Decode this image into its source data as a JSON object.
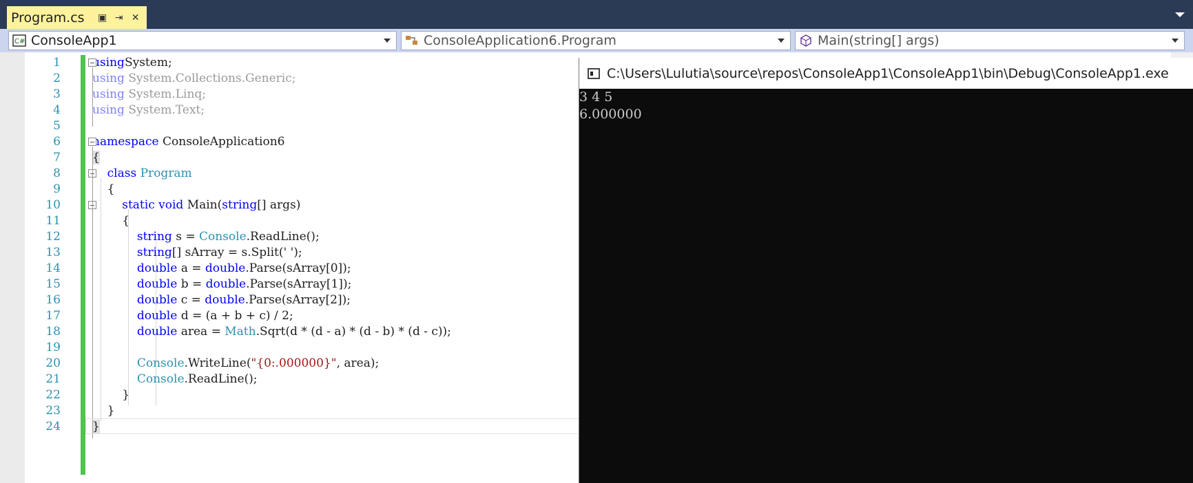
{
  "tab": {
    "title": "Program.cs",
    "pin_glyph": "▣",
    "dock_glyph": "⇥",
    "close_glyph": "✕"
  },
  "navbar": {
    "project": "ConsoleApp1",
    "class": "ConsoleApplication6.Program",
    "member": "Main(string[] args)"
  },
  "line_numbers": [
    "1",
    "2",
    "3",
    "4",
    "5",
    "6",
    "7",
    "8",
    "9",
    "10",
    "11",
    "12",
    "13",
    "14",
    "15",
    "16",
    "17",
    "18",
    "19",
    "20",
    "21",
    "22",
    "23",
    "24"
  ],
  "code_lines": [
    [
      [
        "kw",
        "using"
      ],
      [
        "",
        "System;"
      ]
    ],
    [
      [
        "fade-kw",
        "using"
      ],
      [
        "fade",
        " System.Collections.Generic;"
      ]
    ],
    [
      [
        "fade-kw",
        "using"
      ],
      [
        "fade",
        " System.Linq;"
      ]
    ],
    [
      [
        "fade-kw",
        "using"
      ],
      [
        "fade",
        " System.Text;"
      ]
    ],
    [],
    [
      [
        "kw",
        "namespace"
      ],
      [
        "",
        " ConsoleApplication6"
      ]
    ],
    [
      [
        "brace-hl",
        "{"
      ]
    ],
    [
      [
        "",
        "    "
      ],
      [
        "kw",
        "class"
      ],
      [
        "",
        " "
      ],
      [
        "ty",
        "Program"
      ]
    ],
    [
      [
        "",
        "    {"
      ]
    ],
    [
      [
        "",
        "        "
      ],
      [
        "kw",
        "static"
      ],
      [
        "",
        " "
      ],
      [
        "kw",
        "void"
      ],
      [
        "",
        " Main("
      ],
      [
        "kw",
        "string"
      ],
      [
        "",
        "[] args)"
      ]
    ],
    [
      [
        "",
        "        {"
      ]
    ],
    [
      [
        "",
        "            "
      ],
      [
        "kw",
        "string"
      ],
      [
        "",
        " s = "
      ],
      [
        "ty",
        "Console"
      ],
      [
        "",
        ".ReadLine();"
      ]
    ],
    [
      [
        "",
        "            "
      ],
      [
        "kw",
        "string"
      ],
      [
        "",
        "[] sArray = s.Split(' ');"
      ]
    ],
    [
      [
        "",
        "            "
      ],
      [
        "kw",
        "double"
      ],
      [
        "",
        " a = "
      ],
      [
        "kw",
        "double"
      ],
      [
        "",
        ".Parse(sArray[0]);"
      ]
    ],
    [
      [
        "",
        "            "
      ],
      [
        "kw",
        "double"
      ],
      [
        "",
        " b = "
      ],
      [
        "kw",
        "double"
      ],
      [
        "",
        ".Parse(sArray[1]);"
      ]
    ],
    [
      [
        "",
        "            "
      ],
      [
        "kw",
        "double"
      ],
      [
        "",
        " c = "
      ],
      [
        "kw",
        "double"
      ],
      [
        "",
        ".Parse(sArray[2]);"
      ]
    ],
    [
      [
        "",
        "            "
      ],
      [
        "kw",
        "double"
      ],
      [
        "",
        " d = (a + b + c) / 2;"
      ]
    ],
    [
      [
        "",
        "            "
      ],
      [
        "kw",
        "double"
      ],
      [
        "",
        " area = "
      ],
      [
        "ty",
        "Math"
      ],
      [
        "",
        ".Sqrt(d * (d - a) * (d - b) * (d - c));"
      ]
    ],
    [],
    [
      [
        "",
        "            "
      ],
      [
        "ty",
        "Console"
      ],
      [
        "",
        ".WriteLine("
      ],
      [
        "str",
        "\"{0:.000000}\""
      ],
      [
        "",
        ", area);"
      ]
    ],
    [
      [
        "",
        "            "
      ],
      [
        "ty",
        "Console"
      ],
      [
        "",
        ".ReadLine();"
      ]
    ],
    [
      [
        "",
        "        }"
      ]
    ],
    [
      [
        "",
        "    }"
      ]
    ],
    [
      [
        "brace-hl",
        "}"
      ]
    ]
  ],
  "console": {
    "title": "C:\\Users\\Lulutia\\source\\repos\\ConsoleApp1\\ConsoleApp1\\bin\\Debug\\ConsoleApp1.exe",
    "output": [
      "3 4 5",
      "6.000000"
    ]
  }
}
